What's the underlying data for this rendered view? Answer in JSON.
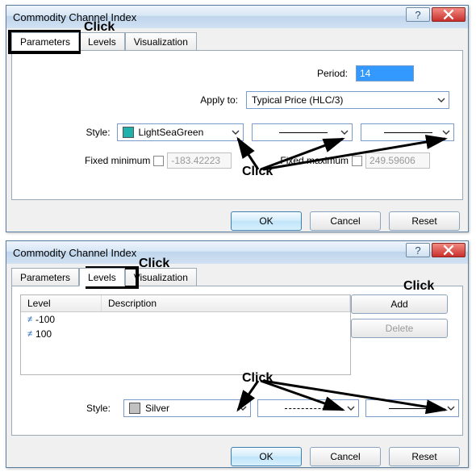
{
  "common": {
    "title": "Commodity Channel Index",
    "tabs": {
      "parameters": "Parameters",
      "levels": "Levels",
      "visualization": "Visualization"
    },
    "buttons": {
      "ok": "OK",
      "cancel": "Cancel",
      "reset": "Reset",
      "add": "Add",
      "delete": "Delete"
    },
    "help_glyph": "?",
    "close_glyph": "✕"
  },
  "dlg1": {
    "period_label": "Period:",
    "period_value": "14",
    "apply_label": "Apply to:",
    "apply_value": "Typical Price (HLC/3)",
    "style_label": "Style:",
    "style_color_name": "LightSeaGreen",
    "style_color_hex": "#20B2AA",
    "fixed_min_label": "Fixed minimum",
    "fixed_min_value": "-183.42223",
    "fixed_max_label": "Fixed maximum",
    "fixed_max_value": "249.59606"
  },
  "dlg2": {
    "grid": {
      "col_level": "Level",
      "col_desc": "Description",
      "rows": [
        {
          "value": "-100",
          "desc": ""
        },
        {
          "value": "100",
          "desc": ""
        }
      ]
    },
    "style_label": "Style:",
    "style_color_name": "Silver",
    "style_color_hex": "#C0C0C0"
  },
  "anno": {
    "click": "Click"
  }
}
